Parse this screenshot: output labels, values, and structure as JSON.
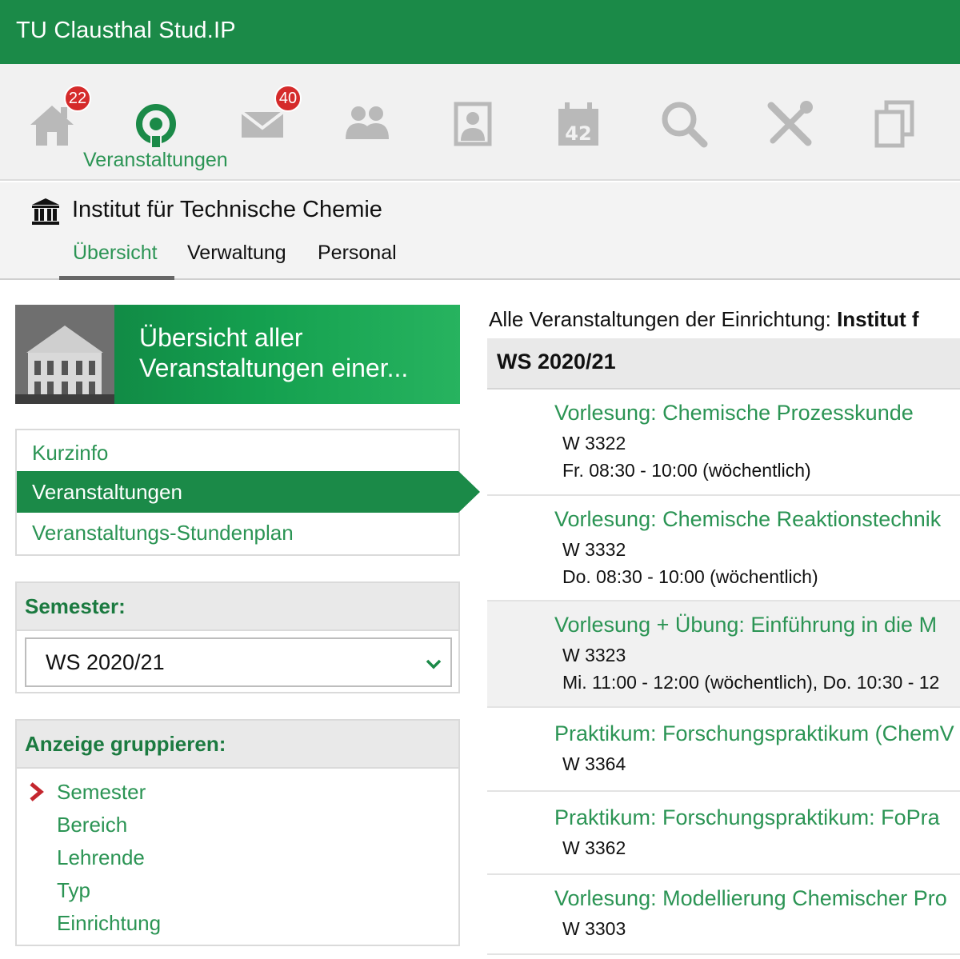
{
  "app": {
    "title": "TU Clausthal Stud.IP"
  },
  "iconnav": {
    "items": [
      {
        "icon": "home-icon",
        "badge": "22"
      },
      {
        "icon": "courses-icon",
        "label": "Veranstaltungen"
      },
      {
        "icon": "mail-icon",
        "badge": "40"
      },
      {
        "icon": "community-icon"
      },
      {
        "icon": "profile-icon"
      },
      {
        "icon": "calendar-icon",
        "calendar_day": "42"
      },
      {
        "icon": "search-icon"
      },
      {
        "icon": "tools-icon"
      },
      {
        "icon": "files-icon"
      }
    ]
  },
  "institute": {
    "title": "Institut für Technische Chemie",
    "tabs": [
      {
        "label": "Übersicht"
      },
      {
        "label": "Verwaltung"
      },
      {
        "label": "Personal"
      }
    ]
  },
  "banner": {
    "line1": "Übersicht aller",
    "line2": "Veranstaltungen einer..."
  },
  "sidebar": {
    "links": [
      {
        "label": "Kurzinfo"
      },
      {
        "label": "Veranstaltungen"
      },
      {
        "label": "Veranstaltungs-Stundenplan"
      }
    ]
  },
  "semester_widget": {
    "title": "Semester:",
    "selected": "WS 2020/21"
  },
  "group_widget": {
    "title": "Anzeige gruppieren:",
    "items": [
      {
        "label": "Semester"
      },
      {
        "label": "Bereich"
      },
      {
        "label": "Lehrende"
      },
      {
        "label": "Typ"
      },
      {
        "label": "Einrichtung"
      }
    ]
  },
  "main": {
    "heading_prefix": "Alle Veranstaltungen der Einrichtung: ",
    "heading_bold": "Institut f",
    "semester_header": "WS 2020/21",
    "courses": [
      {
        "title": "Vorlesung: Chemische Prozesskunde",
        "room": "W 3322",
        "time": "Fr. 08:30 - 10:00 (wöchentlich)"
      },
      {
        "title": "Vorlesung: Chemische Reaktionstechnik",
        "room": "W 3332",
        "time": "Do. 08:30 - 10:00 (wöchentlich)"
      },
      {
        "title": "Vorlesung + Übung: Einführung in die M",
        "room": "W 3323",
        "time": "Mi. 11:00 - 12:00 (wöchentlich), Do. 10:30 - 12"
      },
      {
        "title": "Praktikum: Forschungspraktikum (ChemV",
        "room": "W 3364"
      },
      {
        "title": "Praktikum: Forschungspraktikum: FoPra",
        "room": "W 3362"
      },
      {
        "title": "Vorlesung: Modellierung Chemischer Pro",
        "room": "W 3303"
      }
    ]
  },
  "colors": {
    "brand_green": "#1b8a48",
    "link_green": "#2b9454",
    "badge_red": "#d52b2b",
    "icon_gray": "#b9b9b9"
  }
}
